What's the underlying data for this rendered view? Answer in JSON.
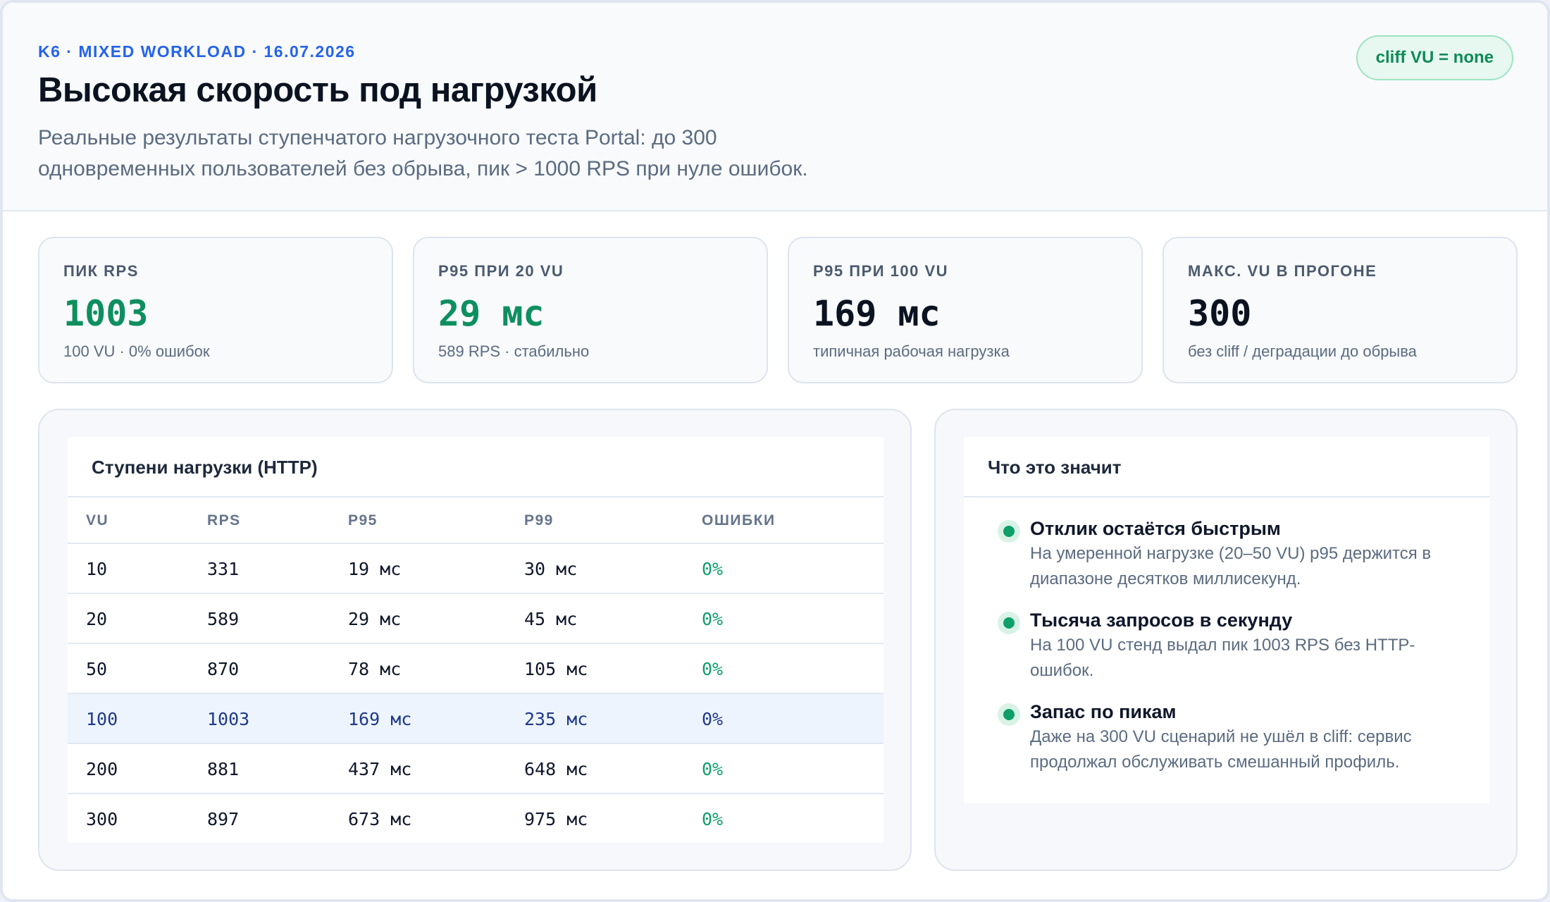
{
  "header": {
    "eyebrow": "K6 · MIXED WORKLOAD · 16.07.2026",
    "title": "Высокая скорость под нагрузкой",
    "subtitle": "Реальные результаты ступенчатого нагрузочного теста Portal: до 300 одновременных пользователей без обрыва, пик > 1000 RPS при нуле ошибок.",
    "badge": "cliff VU = none"
  },
  "cards": [
    {
      "label": "ПИК RPS",
      "value": "1003",
      "sub": "100 VU · 0% ошибок"
    },
    {
      "label": "P95 ПРИ 20 VU",
      "value": "29 мс",
      "sub": "589 RPS · стабильно"
    },
    {
      "label": "P95 ПРИ 100 VU",
      "value": "169 мс",
      "sub": "типичная рабочая нагрузка"
    },
    {
      "label": "МАКС. VU В ПРОГОНЕ",
      "value": "300",
      "sub": "без cliff / деградации до обрыва"
    }
  ],
  "table": {
    "title": "Ступени нагрузки (HTTP)",
    "columns": [
      "VU",
      "RPS",
      "P95",
      "P99",
      "ОШИБКИ"
    ],
    "rows": [
      [
        "10",
        "331",
        "19 мс",
        "30 мс",
        "0%"
      ],
      [
        "20",
        "589",
        "29 мс",
        "45 мс",
        "0%"
      ],
      [
        "50",
        "870",
        "78 мс",
        "105 мс",
        "0%"
      ],
      [
        "100",
        "1003",
        "169 мс",
        "235 мс",
        "0%"
      ],
      [
        "200",
        "881",
        "437 мс",
        "648 мс",
        "0%"
      ],
      [
        "300",
        "897",
        "673 мс",
        "975 мс",
        "0%"
      ]
    ]
  },
  "meaning": {
    "title": "Что это значит",
    "items": [
      {
        "title": "Отклик остаётся быстрым",
        "text": "На умеренной нагрузке (20–50 VU) p95 держится в диапазоне десятков миллисекунд."
      },
      {
        "title": "Тысяча запросов в секунду",
        "text": "На 100 VU стенд выдал пик 1003 RPS без HTTP-ошибок."
      },
      {
        "title": "Запас по пикам",
        "text": "Даже на 300 VU сценарий не ушёл в cliff: сервис продолжал обслуживать смешанный профиль."
      }
    ]
  },
  "colors": {
    "accent_blue": "#2563eb",
    "success_green": "#0e9f6a",
    "highlight_row": "#eef4fd"
  }
}
